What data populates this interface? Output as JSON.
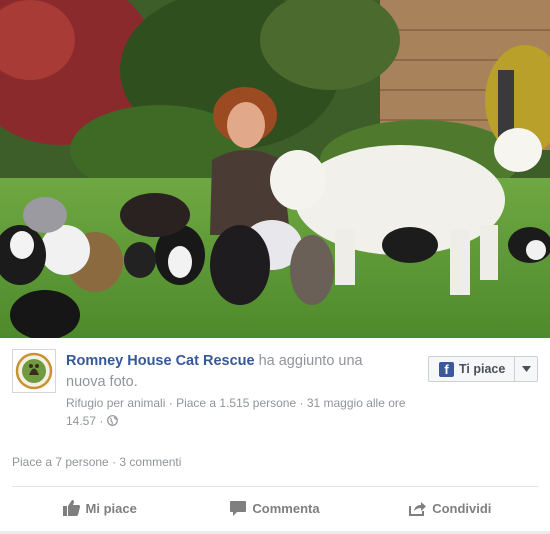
{
  "post": {
    "page_name": "Romney House Cat Rescue",
    "action_text": " ha aggiunto una nuova foto.",
    "category": "Rifugio per animali",
    "page_likes": "Piace a 1.515 persone",
    "date": "31 maggio alle ore 14.57",
    "sep": " · ",
    "avatar_text_top": "ROMNEY HOUSE",
    "avatar_text_bottom": "CAT RESCUE"
  },
  "like_page_button": {
    "label": "Ti piace",
    "icon": "facebook-f-icon"
  },
  "stats": {
    "likes": "Piace a 7 persone",
    "sep": " · ",
    "comments": "3 commenti"
  },
  "actions": [
    {
      "label": "Mi piace",
      "icon": "thumbs-up-icon"
    },
    {
      "label": "Commenta",
      "icon": "comment-icon"
    },
    {
      "label": "Condividi",
      "icon": "share-icon"
    }
  ],
  "photo": {
    "subject": "photo-woman-with-cats-and-dog"
  },
  "colors": {
    "link": "#365899",
    "meta": "#90949c",
    "action": "#7f7f7f",
    "facebook_blue": "#3b5998"
  }
}
